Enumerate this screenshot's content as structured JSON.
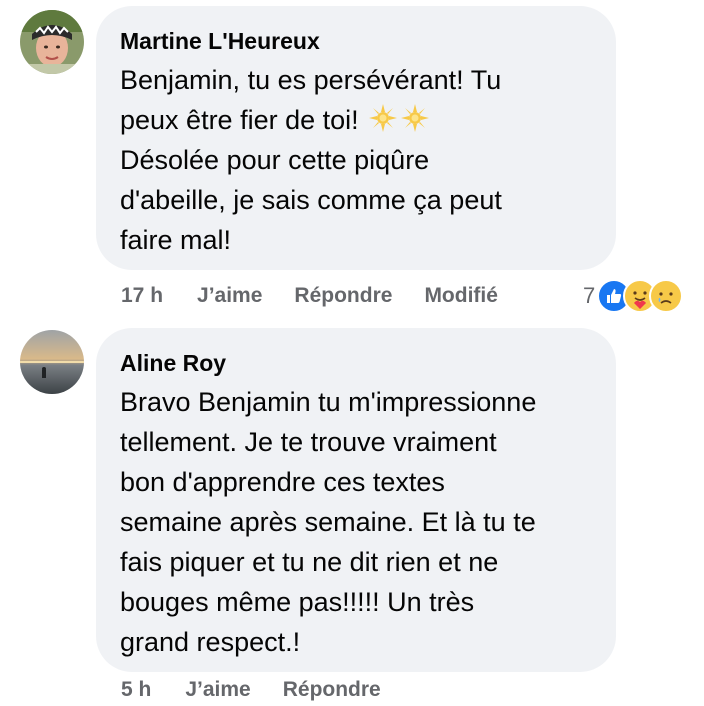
{
  "comments": [
    {
      "author": "Martine L'Heureux",
      "text_line1": "Benjamin, tu es persévérant! Tu",
      "text_line2": "peux être fier de toi!",
      "emoji": "sun-emoji",
      "text_rest": "Désolée pour cette piqûre\nd'abeille, je sais comme ça peut\nfaire mal!",
      "time": "17 h",
      "like_label": "J’aime",
      "reply_label": "Répondre",
      "edited_label": "Modifié",
      "reaction_count": "7",
      "reactions": [
        "like-icon",
        "care-icon",
        "sad-icon"
      ]
    },
    {
      "author": "Aline Roy",
      "text": "Bravo Benjamin tu m'impressionne\ntellement. Je te trouve vraiment\nbon d'apprendre ces textes\nsemaine après semaine. Et là tu te\nfais piquer et tu ne dit rien et ne\nbouges même pas!!!!! Un très\ngrand respect.!",
      "time": "5 h",
      "like_label": "J’aime",
      "reply_label": "Répondre"
    }
  ],
  "colors": {
    "bubble": "#f0f2f5",
    "meta_text": "#65676b",
    "like_blue": "#1877f2"
  }
}
